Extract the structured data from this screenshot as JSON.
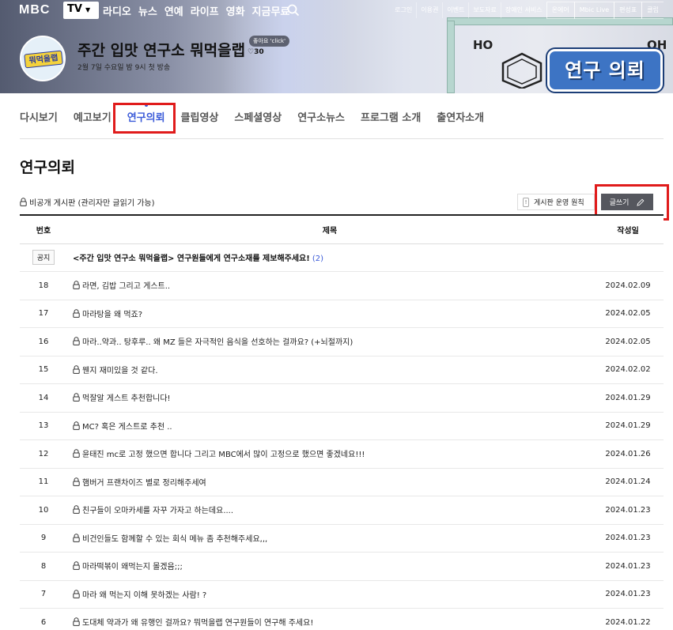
{
  "header": {
    "logo": "MBC",
    "tv_selector": "TV",
    "main_menu": [
      "라디오",
      "뉴스",
      "연예",
      "라이프",
      "영화",
      "지금무료"
    ],
    "util_menu": [
      "로그인",
      "이용권",
      "이벤트",
      "보도자료",
      "장애인 서비스"
    ],
    "util_boxes": [
      "온에어",
      "Mbic Live",
      "편성표",
      "클립"
    ],
    "search_icon": "search-icon"
  },
  "program": {
    "logo_text": "뭐먹을랩",
    "title": "주간 입맛 연구소 뭐먹을랩",
    "like_badge": "좋아요 'click'",
    "like_count": "♡30",
    "airtime": "2월 7일 수요일 밤 9시 첫 방송",
    "banner_sign": "연구 의뢰",
    "banner_chem_left": "HO",
    "banner_chem_right": "OH"
  },
  "subnav": {
    "tabs": [
      "다시보기",
      "예고보기",
      "연구의뢰",
      "클립영상",
      "스페셜영상",
      "연구소뉴스",
      "프로그램 소개",
      "출연자소개"
    ],
    "active_index": 2
  },
  "page_title": "연구의뢰",
  "board": {
    "private_note": "비공개 게시판 (관리자만 글읽기 가능)",
    "rules_button": "게시판 운영 원칙",
    "write_button": "글쓰기",
    "columns": {
      "num": "번호",
      "title": "제목",
      "date": "작성일"
    },
    "notice": {
      "badge": "공지",
      "title": "<주간 입맛 연구소 뭐먹을랩> 연구원들에게 연구소재를 제보해주세요!",
      "comments": "(2)"
    },
    "rows": [
      {
        "num": "18",
        "title": "라면, 김밥 그리고 게스트..",
        "date": "2024.02.09"
      },
      {
        "num": "17",
        "title": "마라탕을 왜 먹죠?",
        "date": "2024.02.05"
      },
      {
        "num": "16",
        "title": "마라..약과.. 탕후루.. 왜 MZ 들은 자극적인 음식을 선호하는 걸까요? (+뇌절까지)",
        "date": "2024.02.05"
      },
      {
        "num": "15",
        "title": "웬지 재미있을 것 같다.",
        "date": "2024.02.02"
      },
      {
        "num": "14",
        "title": "먹잘알 게스트 추천합니다!",
        "date": "2024.01.29"
      },
      {
        "num": "13",
        "title": "MC? 혹은 게스트로 추천 ..",
        "date": "2024.01.29"
      },
      {
        "num": "12",
        "title": "윤태진 mc로 고정 했으면 합니다 그리고 MBC에서 많이 고정으로 했으면 좋겠네요!!!",
        "date": "2024.01.26"
      },
      {
        "num": "11",
        "title": "햄버거 프랜차이즈 별로 정리해주세여",
        "date": "2024.01.24"
      },
      {
        "num": "10",
        "title": "친구들이 오마카세를 자꾸 가자고 하는데요....",
        "date": "2024.01.23"
      },
      {
        "num": "9",
        "title": "비건인들도 함께할 수 있는 회식 메뉴 좀 추천해주세요,,,",
        "date": "2024.01.23"
      },
      {
        "num": "8",
        "title": "마라떡볶이 왜먹는지 몰겠음;;;",
        "date": "2024.01.23"
      },
      {
        "num": "7",
        "title": "마라 왜 먹는지 이해 못하겠는 사람! ?",
        "date": "2024.01.23"
      },
      {
        "num": "6",
        "title": "도대체 약과가 왜 유행인 걸까요? 뭐먹을랩 연구원들이 연구해 주세요!",
        "date": "2024.01.22"
      }
    ]
  },
  "colors": {
    "accent": "#3b5bd9",
    "highlight_box": "#e01b1b",
    "write_button": "#55575e"
  }
}
